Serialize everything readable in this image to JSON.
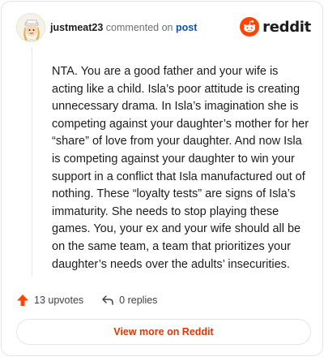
{
  "header": {
    "username": "justmeat23",
    "action_text": "commented on",
    "post_link": "post",
    "brand_name": "reddit",
    "brand_color": "#ff4500"
  },
  "comment": {
    "text": "NTA. You are a good father and your wife is acting like a child. Isla’s poor attitude is creating unnecessary drama. In Isla’s imagination she is competing against your daughter’s mother for her “share” of love from your daughter. And now Isla is competing against your daughter to win your support in a conflict that Isla manufactured out of nothing. These “loyalty tests” are signs of Isla’s immaturity. She needs to stop playing these games. You, your ex and your wife should all be on the same team, a team that prioritizes your daughter’s needs over the adults’ insecurities."
  },
  "footer": {
    "upvotes": "13 upvotes",
    "replies": "0 replies"
  },
  "view_more_label": "View more on Reddit",
  "icons": {
    "avatar": "cartoon-avatar",
    "brand": "reddit-snoo-icon",
    "upvote": "upvote-arrow-icon",
    "reply": "reply-arrow-icon"
  },
  "colors": {
    "upvote": "#ff4500",
    "link": "#0f4fb5",
    "cta": "#d93900"
  }
}
